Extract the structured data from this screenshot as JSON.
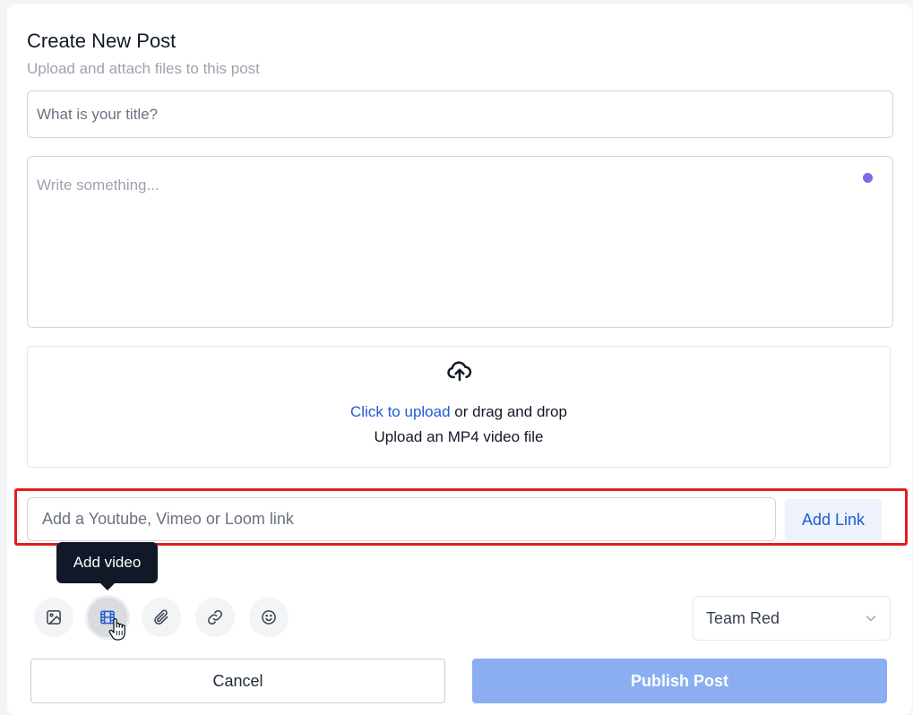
{
  "header": {
    "title": "Create New Post",
    "subtitle": "Upload and attach files to this post"
  },
  "form": {
    "title_placeholder": "What is your title?",
    "title_value": "",
    "body_placeholder": "Write something...",
    "body_value": ""
  },
  "upload": {
    "icon": "cloud-upload-icon",
    "link_text": "Click to upload",
    "rest_text": " or drag and drop",
    "hint": "Upload an MP4 video file"
  },
  "video_link": {
    "placeholder": "Add a Youtube, Vimeo or Loom link",
    "value": "",
    "button_label": "Add Link"
  },
  "tooltip": {
    "text": "Add video"
  },
  "toolbar": {
    "items": [
      {
        "name": "image-icon"
      },
      {
        "name": "video-icon",
        "active": true
      },
      {
        "name": "paperclip-icon"
      },
      {
        "name": "link-icon"
      },
      {
        "name": "emoji-icon"
      }
    ]
  },
  "team_select": {
    "selected": "Team Red"
  },
  "actions": {
    "cancel_label": "Cancel",
    "publish_label": "Publish Post"
  },
  "colors": {
    "accent": "#1d5bd6",
    "publish_disabled": "#8aaef1",
    "highlight_border": "#e11d1d",
    "status_dot": "#7c6ae8",
    "tooltip_bg": "#111827"
  }
}
